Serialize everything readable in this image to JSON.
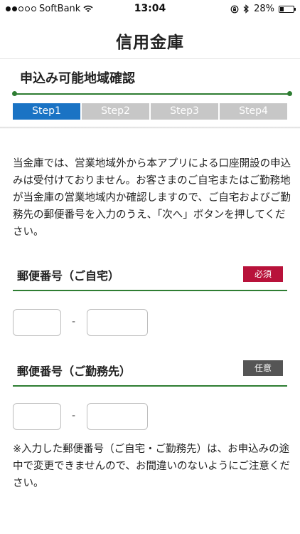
{
  "status_bar": {
    "carrier": "SoftBank",
    "time": "13:04",
    "battery": "28%",
    "battery_level": 0.28
  },
  "header": {
    "title": "信用金庫"
  },
  "page": {
    "section_title": "申込み可能地域確認",
    "steps": [
      "Step1",
      "Step2",
      "Step3",
      "Step4"
    ],
    "active_step": 1
  },
  "intro": {
    "text": "当金庫では、営業地域外から本アプリによる口座開設の申込みは受付けておりません。お客さまのご自宅またはご勤務地が当金庫の営業地域内か確認しますので、ご自宅およびご勤務先の郵便番号を入力のうえ、「次へ」ボタンを押してください。"
  },
  "home_zip": {
    "label": "郵便番号（ご自宅）",
    "badge": "必須",
    "separator": "-",
    "part1": "",
    "part2": ""
  },
  "work_zip": {
    "label": "郵便番号（ご勤務先）",
    "badge": "任意",
    "separator": "-",
    "part1": "",
    "part2": ""
  },
  "note": {
    "text": "※入力した郵便番号（ご自宅・ご勤務先）は、お申込みの途中で変更できませんので、お間違いのないようにご注意ください。"
  },
  "colors": {
    "accent_green": "#2e7d32",
    "active_step": "#1a73c4",
    "inactive_step": "#c7c7c7",
    "required_badge": "#b8123a",
    "optional_badge": "#555555"
  }
}
